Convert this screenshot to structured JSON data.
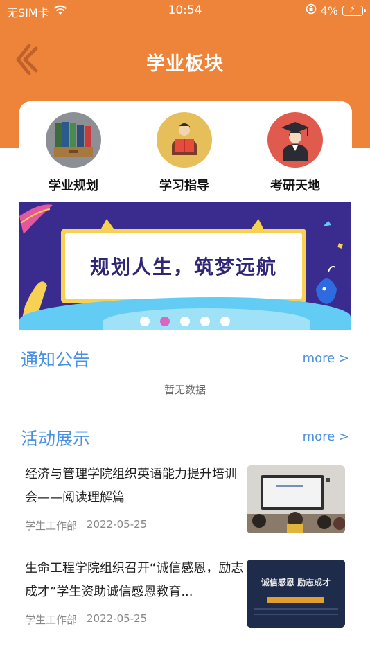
{
  "status_bar": {
    "carrier": "无SIM卡",
    "time": "10:54",
    "battery": "4%"
  },
  "header": {
    "title": "学业板块"
  },
  "quick_links": [
    {
      "label": "学业规划",
      "icon": "bookshelf-icon"
    },
    {
      "label": "学习指导",
      "icon": "reading-student-icon"
    },
    {
      "label": "考研天地",
      "icon": "graduate-icon"
    }
  ],
  "banner": {
    "text": "规划人生，筑梦远航",
    "slide_count": 5,
    "active_slide": 2
  },
  "notices": {
    "title": "通知公告",
    "more": "more >",
    "empty": "暂无数据"
  },
  "activities": {
    "title": "活动展示",
    "more": "more >",
    "items": [
      {
        "title": "经济与管理学院组织英语能力提升培训会——阅读理解篇",
        "source": "学生工作部",
        "date": "2022-05-25"
      },
      {
        "title": "生命工程学院组织召开“诚信感恩，励志成才”学生资助诚信感恩教育...",
        "source": "学生工作部",
        "date": "2022-05-25"
      }
    ],
    "thumb2_text": "诚信感恩  励志成才"
  },
  "colors": {
    "header": "#EE843A",
    "accent_blue": "#4A90E2",
    "banner_bg": "#3A2C8F"
  }
}
